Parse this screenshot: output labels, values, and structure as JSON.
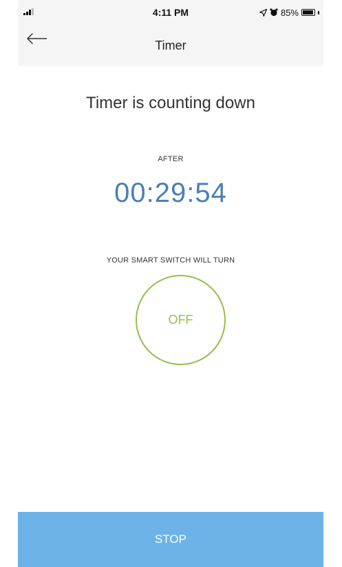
{
  "status_bar": {
    "time": "4:11 PM",
    "battery": "85%",
    "icons": [
      "signal-icon",
      "location-icon",
      "alarm-icon",
      "battery-icon"
    ]
  },
  "nav": {
    "back_icon": "arrow-left-icon",
    "title": "Timer"
  },
  "main": {
    "headline": "Timer is counting down",
    "after_label": "AFTER",
    "countdown": "00:29:54",
    "switch_label": "YOUR SMART SWITCH WILL TURN",
    "target_state": "OFF"
  },
  "footer": {
    "stop_label": "STOP"
  },
  "colors": {
    "countdown": "#4a7fb3",
    "state_ring": "#94bf4a",
    "stop_button": "#6db3e8",
    "header_bg": "#f5f5f5"
  }
}
